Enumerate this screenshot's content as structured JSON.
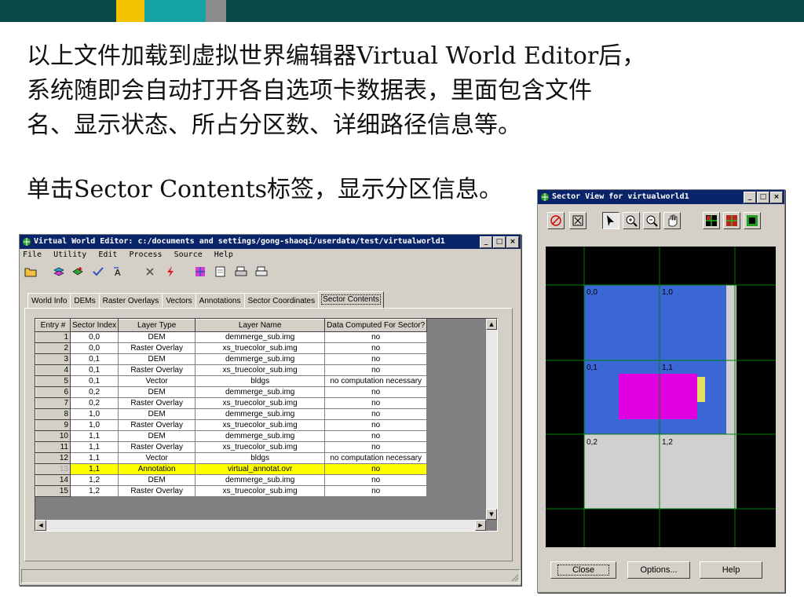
{
  "slide": {
    "colors": {
      "band": "#0b4a4a",
      "yellow": "#f5c400",
      "teal": "#13a3a3",
      "gray": "#8c8c8c"
    },
    "paragraph1": [
      "以上文件加载到虚拟世界编辑器Virtual World Editor后，",
      "系统随即会自动打开各自选项卡数据表，里面包含文件",
      "名、显示状态、所占分区数、详细路径信息等。"
    ],
    "paragraph2": "单击Sector Contents标签，显示分区信息。"
  },
  "editor": {
    "title": "Virtual World Editor: c:/documents and settings/gong-shaoqi/userdata/test/virtualworld1",
    "menu": [
      "File",
      "Utility",
      "Edit",
      "Process",
      "Source",
      "Help"
    ],
    "toolbar_icons": [
      "open-folder-icon",
      "layers-icon",
      "add-layer-icon",
      "check-icon",
      "text-layer-icon",
      "delete-icon",
      "lightning-icon",
      "grid-icon",
      "preview-icon",
      "print-icon",
      "export-icon"
    ],
    "tabs": [
      "World Info",
      "DEMs",
      "Raster Overlays",
      "Vectors",
      "Annotations",
      "Sector Coordinates",
      "Sector Contents"
    ],
    "active_tab": "Sector Contents",
    "table": {
      "headers": [
        "Entry #",
        "Sector Index",
        "Layer Type",
        "Layer Name",
        "Data Computed For Sector?"
      ],
      "rows": [
        [
          "1",
          "0,0",
          "DEM",
          "demmerge_sub.img",
          "no"
        ],
        [
          "2",
          "0,0",
          "Raster Overlay",
          "xs_truecolor_sub.img",
          "no"
        ],
        [
          "3",
          "0,1",
          "DEM",
          "demmerge_sub.img",
          "no"
        ],
        [
          "4",
          "0,1",
          "Raster Overlay",
          "xs_truecolor_sub.img",
          "no"
        ],
        [
          "5",
          "0,1",
          "Vector",
          "bldgs",
          "no computation necessary"
        ],
        [
          "6",
          "0,2",
          "DEM",
          "demmerge_sub.img",
          "no"
        ],
        [
          "7",
          "0,2",
          "Raster Overlay",
          "xs_truecolor_sub.img",
          "no"
        ],
        [
          "8",
          "1,0",
          "DEM",
          "demmerge_sub.img",
          "no"
        ],
        [
          "9",
          "1,0",
          "Raster Overlay",
          "xs_truecolor_sub.img",
          "no"
        ],
        [
          "10",
          "1,1",
          "DEM",
          "demmerge_sub.img",
          "no"
        ],
        [
          "11",
          "1,1",
          "Raster Overlay",
          "xs_truecolor_sub.img",
          "no"
        ],
        [
          "12",
          "1,1",
          "Vector",
          "bldgs",
          "no computation necessary"
        ],
        [
          "13",
          "1,1",
          "Annotation",
          "virtual_annotat.ovr",
          "no"
        ],
        [
          "14",
          "1,2",
          "DEM",
          "demmerge_sub.img",
          "no"
        ],
        [
          "15",
          "1,2",
          "Raster Overlay",
          "xs_truecolor_sub.img",
          "no"
        ]
      ],
      "highlighted_entry": "13"
    }
  },
  "sector_view": {
    "title": "Sector View for virtualworld1",
    "tools": [
      "target-icon",
      "fit-extent-icon",
      "arrow-select-icon",
      "zoom-in-icon",
      "zoom-out-icon",
      "pan-hand-icon",
      "sector-grid-green-icon",
      "sector-grid-red-icon",
      "sector-grid-black-icon"
    ],
    "labels": [
      "0,0",
      "1,0",
      "0,1",
      "1,1",
      "0,2",
      "1,2"
    ],
    "colors": {
      "dem": "#3a66d6",
      "raster": "#d0d0d0",
      "vector": "#e000e0",
      "annotation": "#e6e060",
      "grid": "#008000"
    },
    "buttons": {
      "close": "Close",
      "options": "Options...",
      "help": "Help"
    }
  }
}
